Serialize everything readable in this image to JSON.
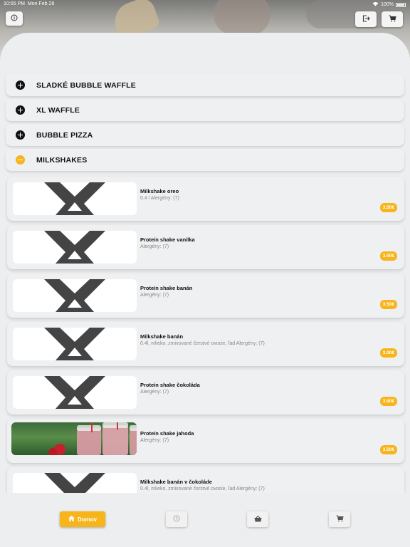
{
  "status_bar": {
    "time": "10:55 PM",
    "date": "Mon Feb 28",
    "battery": "100%"
  },
  "header": {
    "info_icon": "info-icon",
    "logout_icon": "logout-icon",
    "cart_icon": "cart-icon"
  },
  "categories": [
    {
      "label": "SLADKÉ BUBBLE WAFFLE",
      "state": "collapsed"
    },
    {
      "label": "XL WAFFLE",
      "state": "collapsed"
    },
    {
      "label": "BUBBLE PIZZA",
      "state": "collapsed"
    },
    {
      "label": "MILKSHAKES",
      "state": "expanded"
    }
  ],
  "products": [
    {
      "name": "Milkshake oreo",
      "desc": "0.4 l Alergény: (7)",
      "price": "3.50€"
    },
    {
      "name": "Proteín shake vanilka",
      "desc": " Alergény: (7)",
      "price": "3.50€"
    },
    {
      "name": "Proteín shake banán",
      "desc": " Alergény: (7)",
      "price": "3.50€"
    },
    {
      "name": "Milkshake banán",
      "desc": "0.4l, mlieko, zmixované čerstvé ovocie, ľad Alergény: (7)",
      "price": "3.00€"
    },
    {
      "name": "Proteín shake čokoláda",
      "desc": " Alergény: (7)",
      "price": "3.50€"
    },
    {
      "name": "Proteín shake jahoda",
      "desc": " Alergény: (7)",
      "price": "3.50€"
    },
    {
      "name": "Milkshake banán v čokoláde",
      "desc": "0.4l, mlieko, zmixované čerstvé ovocie, ľad Alergény: (7)",
      "price": ""
    }
  ],
  "bottom_nav": {
    "home_label": "Domov"
  },
  "colors": {
    "accent": "#f7b51b",
    "background": "#eceef0"
  }
}
